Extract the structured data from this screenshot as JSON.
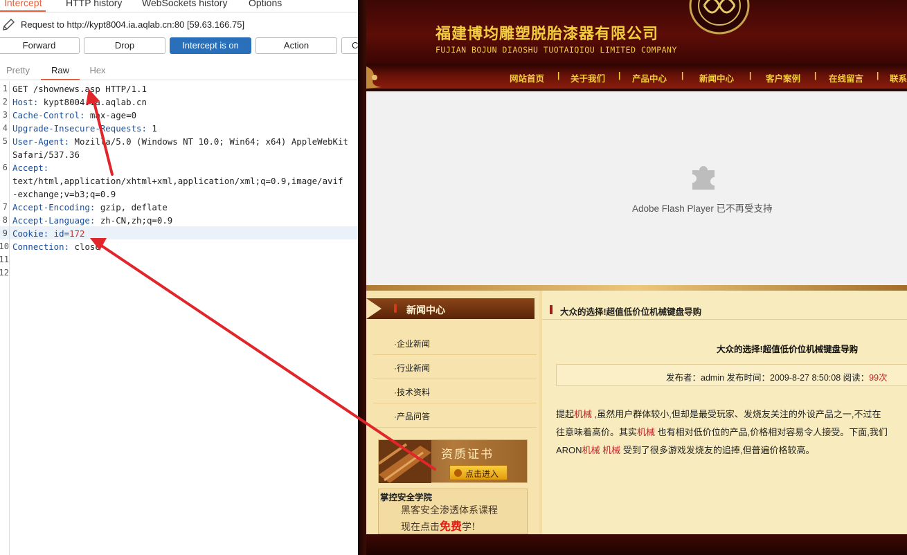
{
  "burp": {
    "top_tabs": [
      "Intercept",
      "HTTP history",
      "WebSockets history",
      "Options"
    ],
    "request_label": "Request to http://kypt8004.ia.aqlab.cn:80  [59.63.166.75]",
    "buttons": {
      "forward": "Forward",
      "drop": "Drop",
      "intercept": "Intercept is on",
      "action": "Action",
      "overflow": "C"
    },
    "view_tabs": [
      "Pretty",
      "Raw",
      "Hex"
    ],
    "line_numbers": [
      "1",
      "2",
      "3",
      "4",
      "5",
      "",
      "6",
      "",
      "",
      "7",
      "8",
      "9",
      "10",
      "11",
      "12"
    ],
    "lines": {
      "l1": "GET /shownews.asp HTTP/1.1",
      "l2_name": "Host:",
      "l2_val": " kypt8004.ia.aqlab.cn",
      "l3_name": "Cache-Control:",
      "l3_val": " max-age=0",
      "l4_name": "Upgrade-Insecure-Requests:",
      "l4_val": " 1",
      "l5_name": "User-Agent:",
      "l5_val": " Mozilla/5.0 (Windows NT 10.0; Win64; x64) AppleWebKit",
      "l5b": "Safari/537.36",
      "l6_name": "Accept:",
      "l6b": "text/html,application/xhtml+xml,application/xml;q=0.9,image/avif",
      "l6c": "-exchange;v=b3;q=0.9",
      "l7_name": "Accept-Encoding:",
      "l7_val": " gzip, deflate",
      "l8_name": "Accept-Language:",
      "l8_val": " zh-CN,zh;q=0.9",
      "l9_name": "Cookie:",
      "l9_key": " id=",
      "l9_val": "172",
      "l10_name": "Connection:",
      "l10_val": " close"
    }
  },
  "site": {
    "cn_title": "福建博均雕塑脱胎漆器有限公司",
    "en_title": "FUJIAN BOJUN DIAOSHU  TUOTAIQIQU  LIMITED COMPANY",
    "nav": [
      "网站首页",
      "关于我们",
      "产品中心",
      "新闻中心",
      "客户案例",
      "在线留言",
      "联系"
    ],
    "nav_sep": "|",
    "flash_notice": "Adobe Flash Player 已不再受支持",
    "side_header": "新闻中心",
    "side_links": [
      "·企业新闻",
      "·行业新闻",
      "·技术资料",
      "·产品问答"
    ],
    "cert_title": "资质证书",
    "cert_button": "点击进入",
    "academy_title": "掌控安全学院",
    "academy_line1": "黑客安全渗透体系课程",
    "academy_line2_a": "现在点击",
    "academy_line2_free": "免费",
    "academy_line2_b": "学!",
    "article_head": "大众的选择!超值低价位机械键盘导购",
    "article_title": "大众的选择!超值低价位机械键盘导购",
    "meta": "发布者：admin 发布时间：2009-8-27 8:50:08 阅读：",
    "meta_views": "99次",
    "para1_a": "提起",
    "para1_kw": "机械",
    "para1_b": " ,虽然用户群体较小,但却是最受玩家、发烧友关注的外设产品之一,不过在",
    "para2_a": "往意味着高价。其实",
    "para2_kw": "机械",
    "para2_b": " 也有相对低价位的产品,价格相对容易令人接受。下面,我们",
    "para3_a": "ARON",
    "para3_kw1": "机械",
    "para3_sp": " ",
    "para3_kw2": "机械",
    "para3_b": " 受到了很多游戏发烧友的追捧,但普遍价格较高。"
  },
  "colors": {
    "burp_accent": "#e8603a",
    "burp_primary_button": "#2a6fba",
    "site_gold_text": "#f2cd3c",
    "site_banner_red": "#5c0d07",
    "annotation_arrow": "#e0262a"
  }
}
